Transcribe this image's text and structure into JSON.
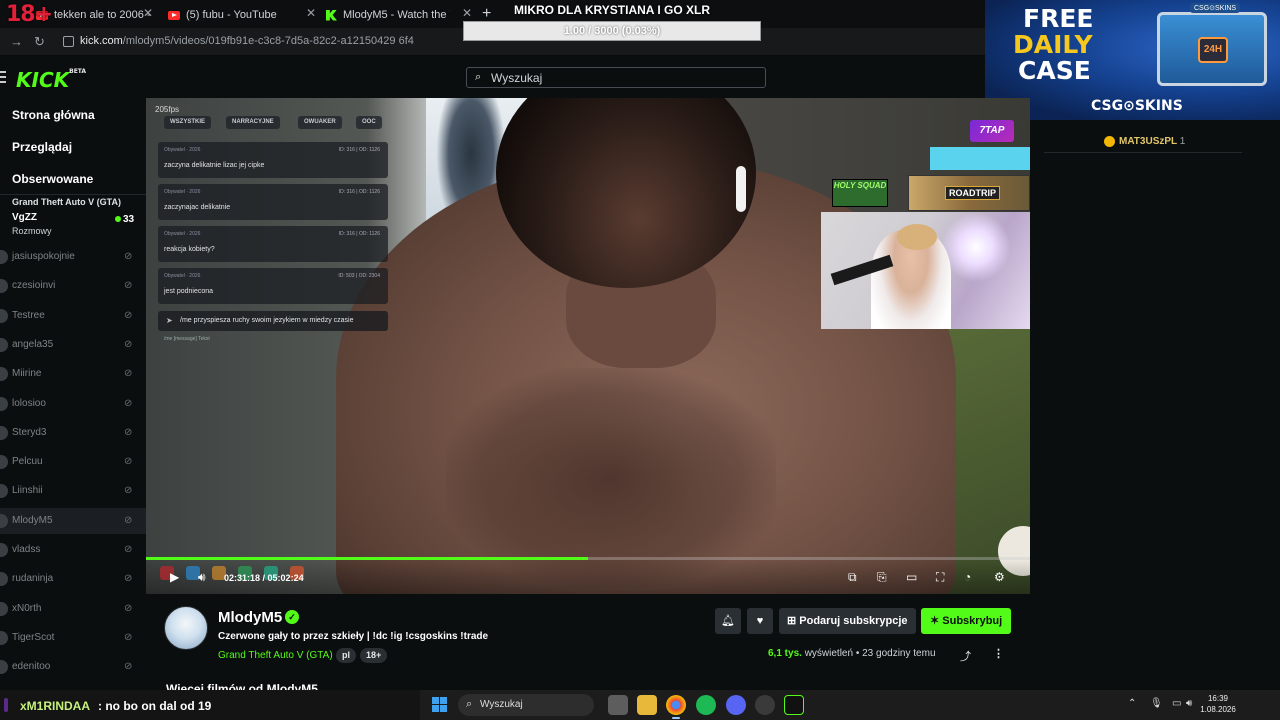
{
  "overlay": {
    "age_badge": "18+",
    "goal_title": "MIKRO DLA KRYSTIANA I GO XLR",
    "goal_progress": "1.00 / 3000 (0.03%)",
    "goal_fraction": 0.0003
  },
  "browser": {
    "tabs": [
      {
        "label": "tekken ale to 2006 - YouTub",
        "icon": "youtube-icon"
      },
      {
        "label": "(5) fubu - YouTube",
        "icon": "youtube-icon"
      },
      {
        "label": "MlodyM5 - Watch the VOD on",
        "icon": "kick-icon"
      }
    ],
    "new_tab": "+",
    "url_host": "kick.com",
    "url_path": "/mlodym5/videos/019fb91e-c3c8-7d5a-82c2-a12150429 6f4"
  },
  "header": {
    "logo": "KICK",
    "logo_badge": "BETA",
    "search_placeholder": "Wyszukaj"
  },
  "sidebar": {
    "nav": [
      "Strona główna",
      "Przeglądaj",
      "Obserwowane"
    ],
    "live": {
      "category": "Grand Theft Auto V (GTA)",
      "name": "VgZZ",
      "sub": "Rozmowy",
      "viewers": "33"
    },
    "offline": [
      "jasiuspokojnie",
      "czesioinvi",
      "Testree",
      "angela35",
      "Miirine",
      "lolosioo",
      "Steryd3",
      "Pelcuu",
      "Liinshii",
      "MlodyM5",
      "vladss",
      "rudaninja",
      "xN0rth",
      "TigerScot",
      "edenitoo"
    ]
  },
  "video": {
    "fps_label": "205fps",
    "game_chat_tabs": [
      "WSZYSTKIE",
      "NARRACYJNE",
      "OWUAKER",
      "OOC"
    ],
    "game_chat_messages": [
      {
        "meta": "Obywatel · 2026",
        "ids": "ID: 316 | OD: 1126",
        "text": "zaczyna delikatnie lizac jej cipke"
      },
      {
        "meta": "Obywatel · 2026",
        "ids": "ID: 316 | OD: 1126",
        "text": "zaczynajac delikatnie"
      },
      {
        "meta": "Obywatel · 2026",
        "ids": "ID: 316 | OD: 1126",
        "text": "reakcja kobiety?"
      },
      {
        "meta": "Obywatel · 2026",
        "ids": "ID: 503 | OD: 2304",
        "text": "jest podniecona"
      }
    ],
    "game_chat_input": "/me przyspiesza ruchy swoim jezykiem w miedzy czasie",
    "game_chat_hint": "/me [message] Tekst",
    "holy_squad": "HOLY SQUAD",
    "roadtrip": "ROADTRIP",
    "stream_logo": "7TAP",
    "time_current": "02:31:18",
    "time_total": "05:02:24",
    "progress": 0.5
  },
  "channel": {
    "name": "MlodyM5",
    "title": "Czerwone gały to przez szkieły  | !dc !ig !csgoskins !trade",
    "category": "Grand Theft Auto V (GTA)",
    "tags": [
      "pl",
      "18+"
    ],
    "gift_label": "Podaruj subskrypcje",
    "subscribe_label": "Subskrybuj",
    "views": "6,1 tys.",
    "views_label": "wyświetleń",
    "age": "23 godziny temu",
    "more_videos": "Więcej filmów od MlodyM5"
  },
  "right": {
    "top_gifter": "MAT3USzPL",
    "top_gifter_count": "1"
  },
  "ad": {
    "line1": "FREE",
    "line2": "DAILY",
    "line3": "CASE",
    "brand": "CSG⊙SKINS",
    "box_label": "CSG⊙SKINS",
    "timer": "24H"
  },
  "ticker": {
    "user": "xM1RINDAA",
    "message": ": no bo on dal od 19"
  },
  "taskbar": {
    "search": "Wyszukaj",
    "time": "16:39",
    "date": "1.08.2026"
  },
  "colors": {
    "kick_green": "#53fc18",
    "background": "#0b0e0f",
    "goal_red_badge": "#e2203a",
    "gifter_gold": "#e2c76a"
  }
}
